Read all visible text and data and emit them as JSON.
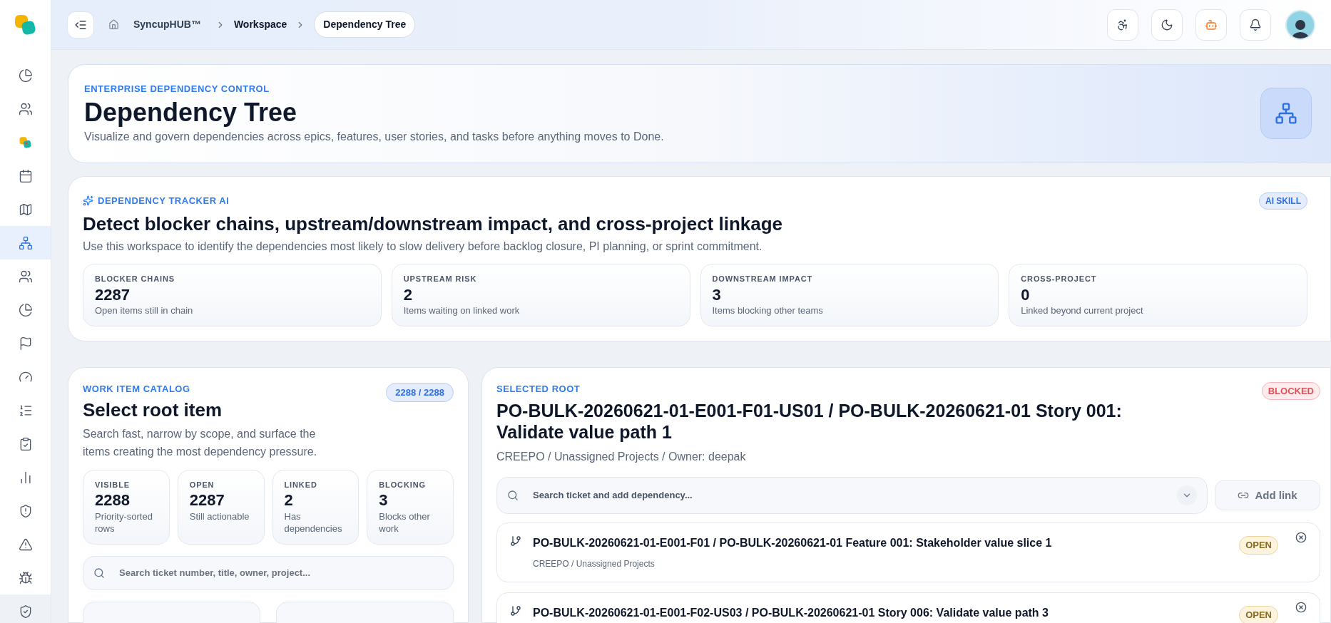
{
  "sidebar": {
    "items": [
      {
        "selected": false
      },
      {
        "selected": false
      },
      {
        "selected": false
      },
      {
        "selected": false
      },
      {
        "selected": false
      },
      {
        "selected": true
      },
      {
        "selected": false
      },
      {
        "selected": false
      },
      {
        "selected": false
      },
      {
        "selected": false
      },
      {
        "selected": false
      },
      {
        "selected": false
      },
      {
        "selected": false
      },
      {
        "selected": false
      },
      {
        "selected": false
      },
      {
        "selected": false
      },
      {
        "selected": false
      }
    ]
  },
  "breadcrumb": [
    "SyncupHUB™",
    "Workspace",
    "Dependency Tree"
  ],
  "header": {
    "eyebrow": "ENTERPRISE DEPENDENCY CONTROL",
    "title": "Dependency Tree",
    "subtitle": "Visualize and govern dependencies across epics, features, user stories, and tasks before anything moves to Done."
  },
  "tracker": {
    "eyebrow": "DEPENDENCY TRACKER AI",
    "badge": "AI SKILL",
    "title": "Detect blocker chains, upstream/downstream impact, and cross-project linkage",
    "subtitle": "Use this workspace to identify the dependencies most likely to slow delivery before backlog closure, PI planning, or sprint commitment.",
    "stats": [
      {
        "label": "BLOCKER CHAINS",
        "value": "2287",
        "note": "Open items still in chain"
      },
      {
        "label": "UPSTREAM RISK",
        "value": "2",
        "note": "Items waiting on linked work"
      },
      {
        "label": "DOWNSTREAM IMPACT",
        "value": "3",
        "note": "Items blocking other teams"
      },
      {
        "label": "CROSS-PROJECT",
        "value": "0",
        "note": "Linked beyond current project"
      }
    ]
  },
  "catalog": {
    "eyebrow": "WORK ITEM CATALOG",
    "count": "2288 / 2288",
    "title": "Select root item",
    "subtitle": "Search fast, narrow by scope, and surface the items creating the most dependency pressure.",
    "stats": [
      {
        "label": "VISIBLE",
        "value": "2288",
        "note": "Priority-sorted rows"
      },
      {
        "label": "OPEN",
        "value": "2287",
        "note": "Still actionable"
      },
      {
        "label": "LINKED",
        "value": "2",
        "note": "Has dependencies"
      },
      {
        "label": "BLOCKING",
        "value": "3",
        "note": "Blocks other work"
      }
    ],
    "search": {
      "placeholder": "Search ticket number, title, owner, project..."
    }
  },
  "root": {
    "eyebrow": "SELECTED ROOT",
    "status": {
      "kind": "blocked",
      "label": "BLOCKED"
    },
    "title": "PO-BULK-20260621-01-E001-F01-US01 / PO-BULK-20260621-01 Story 001: Validate value path 1",
    "meta": "CREEPO / Unassigned Projects / Owner: deepak",
    "search": {
      "placeholder": "Search ticket and add dependency..."
    },
    "add_button": "Add link",
    "dependencies": [
      {
        "title": "PO-BULK-20260621-01-E001-F01 / PO-BULK-20260621-01 Feature 001: Stakeholder value slice 1",
        "meta": "CREEPO / Unassigned Projects",
        "status": {
          "kind": "open",
          "label": "OPEN"
        }
      },
      {
        "title": "PO-BULK-20260621-01-E001-F02-US03 / PO-BULK-20260621-01 Story 006: Validate value path 3",
        "status": {
          "kind": "open",
          "label": "OPEN"
        }
      }
    ]
  }
}
